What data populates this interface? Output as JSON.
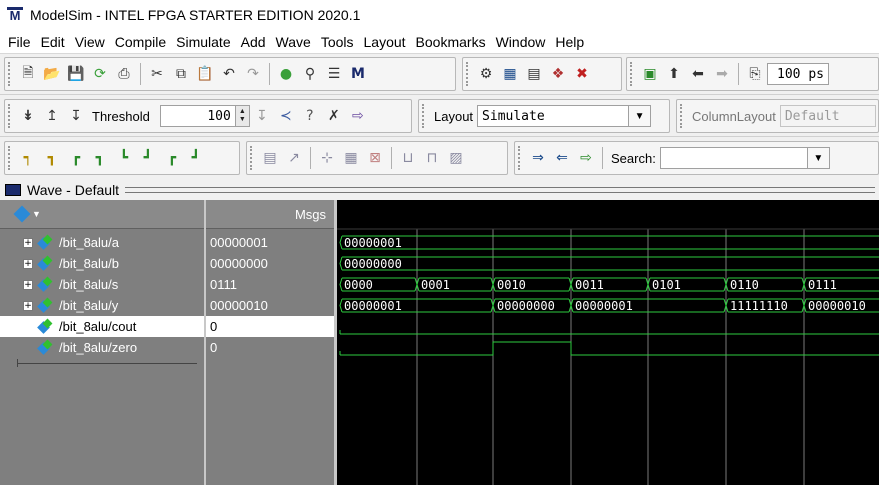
{
  "window": {
    "title": "ModelSim - INTEL FPGA STARTER EDITION 2020.1",
    "logo_letter": "M"
  },
  "menu": [
    "File",
    "Edit",
    "View",
    "Compile",
    "Simulate",
    "Add",
    "Wave",
    "Tools",
    "Layout",
    "Bookmarks",
    "Window",
    "Help"
  ],
  "toolbar1": {
    "run_length": "100 ps"
  },
  "toolbar2": {
    "threshold_label": "Threshold",
    "threshold_value": "100",
    "layout_label": "Layout",
    "layout_value": "Simulate",
    "column_layout_label": "ColumnLayout",
    "column_layout_value": "Default"
  },
  "toolbar3": {
    "search_label": "Search:",
    "search_value": ""
  },
  "wave_window": {
    "title": "Wave - Default",
    "msgs_header": "Msgs",
    "signals": [
      {
        "name": "/bit_8alu/a",
        "value": "00000001",
        "expandable": true,
        "selected": false
      },
      {
        "name": "/bit_8alu/b",
        "value": "00000000",
        "expandable": true,
        "selected": false
      },
      {
        "name": "/bit_8alu/s",
        "value": "0111",
        "expandable": true,
        "selected": false
      },
      {
        "name": "/bit_8alu/y",
        "value": "00000010",
        "expandable": true,
        "selected": false
      },
      {
        "name": "/bit_8alu/cout",
        "value": "0",
        "expandable": false,
        "selected": true
      },
      {
        "name": "/bit_8alu/zero",
        "value": "0",
        "expandable": false,
        "selected": false
      }
    ]
  },
  "waveforms": {
    "bus_color": "#2ecc40",
    "segments": {
      "a": [
        {
          "start": 0,
          "label": "00000001"
        }
      ],
      "b": [
        {
          "start": 0,
          "label": "00000000"
        }
      ],
      "s": [
        {
          "start": 0,
          "label": "0000"
        },
        {
          "start": 1,
          "label": "0001"
        },
        {
          "start": 2,
          "label": "0010"
        },
        {
          "start": 3,
          "label": "0011"
        },
        {
          "start": 4,
          "label": "0101"
        },
        {
          "start": 5,
          "label": "0110"
        },
        {
          "start": 6,
          "label": "0111"
        }
      ],
      "y": [
        {
          "start": 0,
          "label": "00000001"
        },
        {
          "start": 2,
          "label": "00000000"
        },
        {
          "start": 3,
          "label": "00000001"
        },
        {
          "start": 5,
          "label": "11111110"
        },
        {
          "start": 6,
          "label": "00000010"
        }
      ]
    },
    "zero_high": [
      [
        2,
        3
      ]
    ],
    "cout_high": []
  }
}
